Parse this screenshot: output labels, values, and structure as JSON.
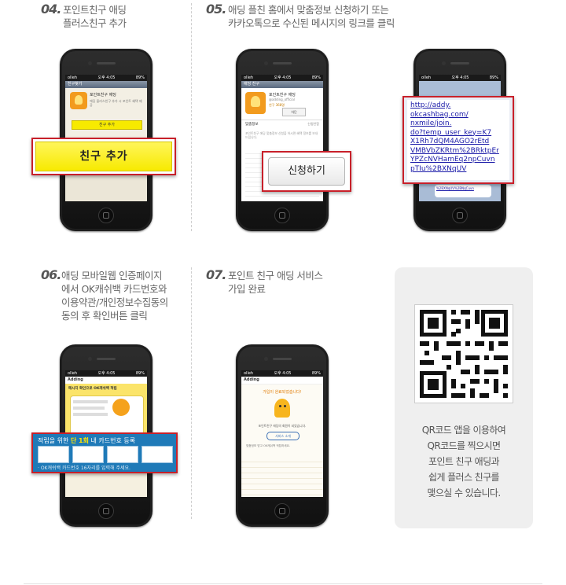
{
  "steps": [
    {
      "num": "04.",
      "text": "포인트친구 애딩\n플러스친구 추가"
    },
    {
      "num": "05.",
      "text": "애딩 플친 홈에서 맞춤정보 신청하기 또는\n카카오톡으로 수신된 메시지의 링크를 클릭"
    },
    {
      "num": "06.",
      "text": "애딩 모바일웹 인증페이지\n에서 OK캐쉬백 카드번호와\n이용약관/개인정보수집동의\n동의 후 확인버튼 클릭"
    },
    {
      "num": "07.",
      "text": "포인트 친구 애딩 서비스\n가입 완료"
    }
  ],
  "phone_status": {
    "carrier": "olleh",
    "time": "오후 4:05",
    "battery": "89%"
  },
  "screen1": {
    "nav": "친구찾기",
    "profile_name": "포인트친구 애딩",
    "profile_desc": "애딩 플러스친구 추가 시 포인트 혜택 제공",
    "add_button": "친구 추가",
    "callout_label": "친구 추가"
  },
  "screen2": {
    "nav": "애딩 친구",
    "profile_name": "포인트친구 애딩",
    "profile_sub": "@adding_official",
    "friends": "친구 368명",
    "block": "차단",
    "tab": "맞춤정보",
    "tab_right": "신청안함",
    "body": "포인트친구 애딩 맞춤정보 신청을 하시면 혜택 정보를 보내드립니다.",
    "callout_label": "신청하기"
  },
  "screen3": {
    "link_lines": [
      "http://addy.",
      "okcashbag.com/",
      "nxmile/join.",
      "do?temp_user_key=K7",
      "X1Rh7dQM4AGO2rEtd",
      "VMBVbZKRtm%2BRktpEr",
      "YPZcNVHamEq2npCuvn",
      "pTIu%2BXNqUV"
    ],
    "below": "%2BXNqUV%2BNqCuvn"
  },
  "screen4": {
    "header": "Adding",
    "notice": "메시지 확인으로 OK캐쉬백 적립",
    "callout_title_pre": "적립을 위한",
    "callout_title_emph": "단 1회",
    "callout_title_post": "내 카드번호 등록",
    "callout_hint": "· OK캐쉬백 카드번호 16자리를 입력해 주세요."
  },
  "screen5": {
    "header": "Adding",
    "title": "가입이 완료되었습니다!",
    "desc": "포인트친구 애딩의 회원이 되었습니다.",
    "button": "서비스 소개",
    "note": "맞춤정보 받고 OK캐쉬백 적립하세요."
  },
  "qr_caption": [
    "QR코드 앱을 이용하여",
    "QR코드를 찍으시면",
    "포인트 친구 애딩과",
    "쉽게 플러스 친구를",
    "맺으실 수 있습니다."
  ],
  "colors": {
    "accent_yellow": "#f7ea00",
    "callout_red": "#c8202a",
    "link_blue": "#1a1aa8",
    "phone_black": "#1e1e1e"
  },
  "icons": [
    "qr-code-icon",
    "home-button-icon"
  ]
}
